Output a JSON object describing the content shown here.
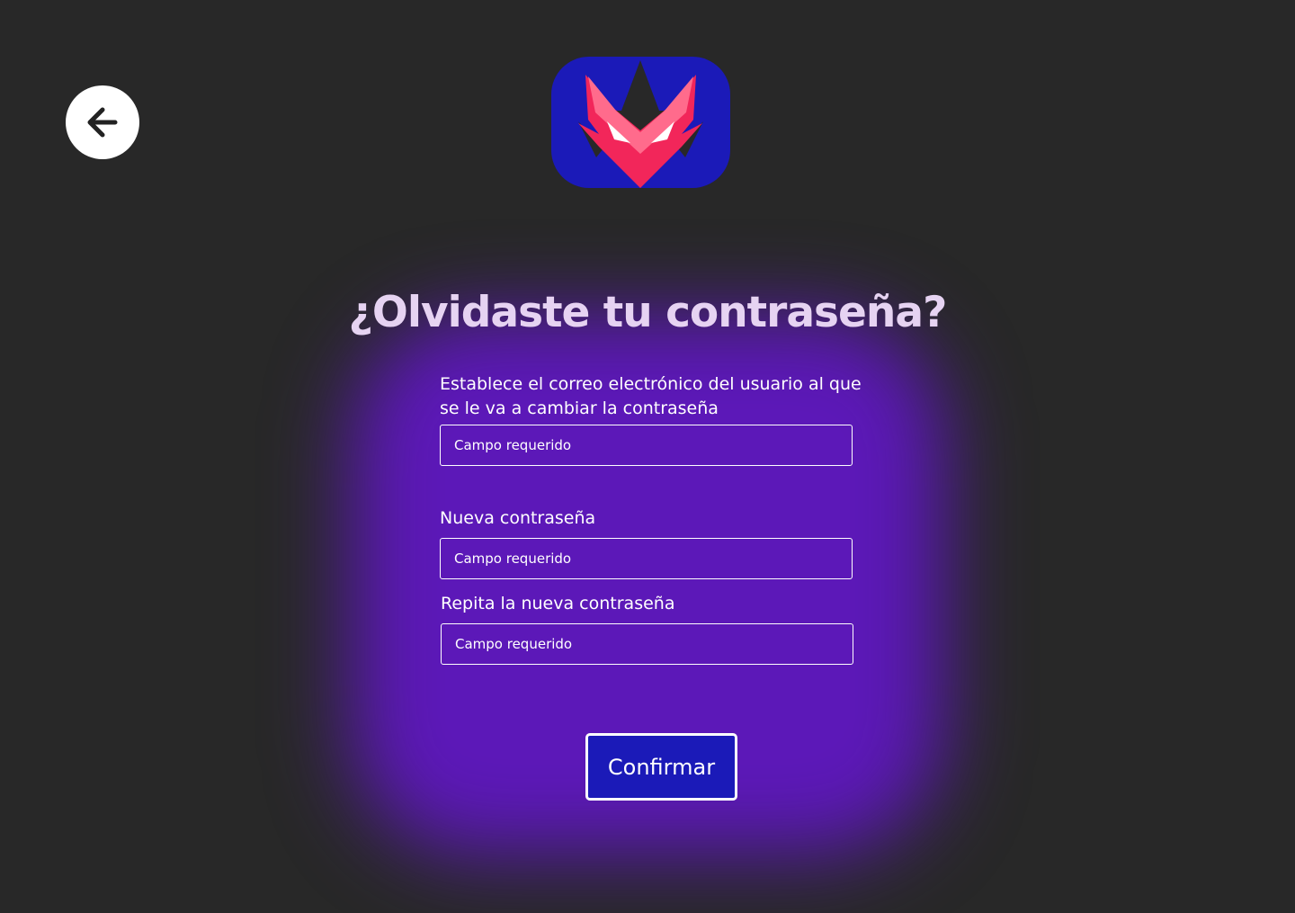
{
  "header": {
    "back_icon": "arrow-left-icon",
    "logo_icon": "fox-logo-icon"
  },
  "form": {
    "title": "¿Olvidaste tu contraseña?",
    "email_label": "Establece el correo electrónico del usuario al que se le va a cambiar la contraseña",
    "email_placeholder": "Campo requerido",
    "email_value": "",
    "new_password_label": "Nueva contraseña",
    "new_password_placeholder": "Campo requerido",
    "new_password_value": "",
    "repeat_password_label": "Repita la nueva contraseña",
    "repeat_password_placeholder": "Campo requerido",
    "repeat_password_value": "",
    "confirm_label": "Confirmar"
  },
  "colors": {
    "background": "#282828",
    "glow": "#5c18b8",
    "logo_bg": "#1b1ab8",
    "logo_fox": "#f2265a",
    "logo_fox_light": "#ff6b8c",
    "button_bg": "#1b1ab8",
    "title": "#e6d3f2"
  }
}
